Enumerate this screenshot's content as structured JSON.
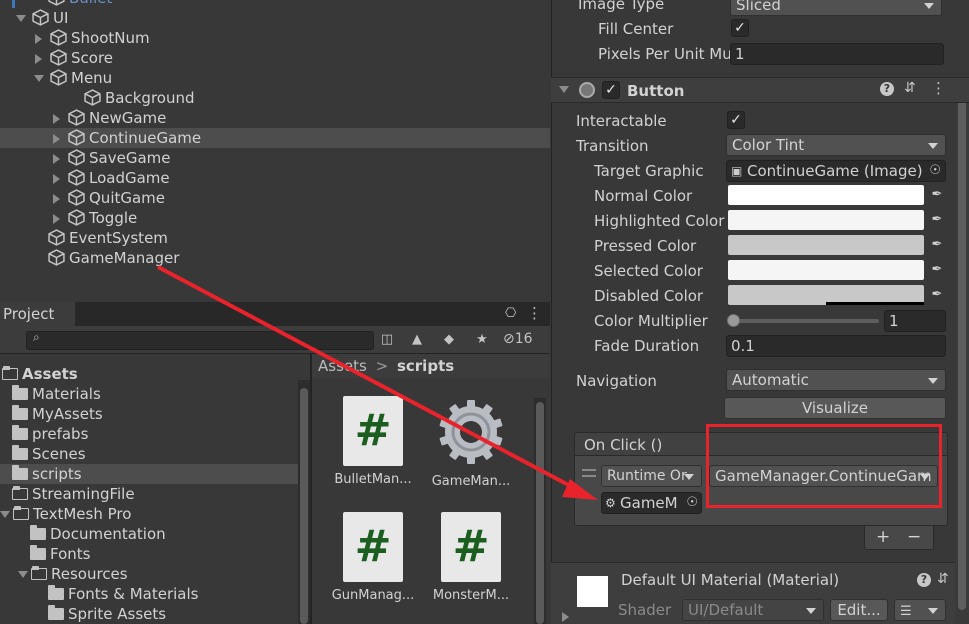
{
  "hierarchy": {
    "items": [
      {
        "label": "Bullet",
        "indent": 48,
        "tri": "none"
      },
      {
        "label": "UI",
        "indent": 32,
        "tri": "down"
      },
      {
        "label": "ShootNum",
        "indent": 50,
        "tri": "right"
      },
      {
        "label": "Score",
        "indent": 50,
        "tri": "right"
      },
      {
        "label": "Menu",
        "indent": 50,
        "tri": "down"
      },
      {
        "label": "Background",
        "indent": 84,
        "tri": "none"
      },
      {
        "label": "NewGame",
        "indent": 68,
        "tri": "right"
      },
      {
        "label": "ContinueGame",
        "indent": 68,
        "tri": "right"
      },
      {
        "label": "SaveGame",
        "indent": 68,
        "tri": "right"
      },
      {
        "label": "LoadGame",
        "indent": 68,
        "tri": "right"
      },
      {
        "label": "QuitGame",
        "indent": 68,
        "tri": "right"
      },
      {
        "label": "Toggle",
        "indent": 68,
        "tri": "right"
      },
      {
        "label": "EventSystem",
        "indent": 48,
        "tri": "none"
      },
      {
        "label": "GameManager",
        "indent": 48,
        "tri": "none"
      }
    ]
  },
  "project": {
    "tab_label": "Project",
    "search_icon": "search-icon",
    "hidden_count": "16",
    "folders": [
      {
        "label": "Assets",
        "indent": 2,
        "open": true,
        "bold": true
      },
      {
        "label": "Materials",
        "indent": 12,
        "open": false
      },
      {
        "label": "MyAssets",
        "indent": 12,
        "open": false
      },
      {
        "label": "prefabs",
        "indent": 12,
        "open": false
      },
      {
        "label": "Scenes",
        "indent": 12,
        "open": false
      },
      {
        "label": "scripts",
        "indent": 12,
        "open": false,
        "selected": true
      },
      {
        "label": "StreamingFile",
        "indent": 12,
        "open": true,
        "empty": true
      },
      {
        "label": "TextMesh Pro",
        "indent": 12,
        "open": true,
        "tri": true
      },
      {
        "label": "Documentation",
        "indent": 30,
        "open": false
      },
      {
        "label": "Fonts",
        "indent": 30,
        "open": false
      },
      {
        "label": "Resources",
        "indent": 30,
        "open": true,
        "tri": true
      },
      {
        "label": "Fonts & Materials",
        "indent": 48,
        "open": false
      },
      {
        "label": "Sprite Assets",
        "indent": 48,
        "open": false
      }
    ],
    "breadcrumb": {
      "root": "Assets",
      "sep": ">",
      "current": "scripts"
    },
    "assets": [
      {
        "label": "BulletMan...",
        "type": "script"
      },
      {
        "label": "GameMan...",
        "type": "gear"
      },
      {
        "label": "GunManag...",
        "type": "script"
      },
      {
        "label": "MonsterM...",
        "type": "script"
      }
    ]
  },
  "inspector": {
    "top": {
      "image_type_label": "Image Type",
      "image_type_value": "Sliced",
      "fill_center_label": "Fill Center",
      "fill_center_check": "✓",
      "ppu_label": "Pixels Per Unit Mu",
      "ppu_value": "1"
    },
    "button_component": {
      "title": "Button",
      "enabled_check": "✓",
      "interactable_label": "Interactable",
      "interactable_check": "✓",
      "transition_label": "Transition",
      "transition_value": "Color Tint",
      "target_graphic_label": "Target Graphic",
      "target_graphic_value": "ContinueGame (Image)",
      "colors": [
        {
          "label": "Normal Color",
          "hex": "#ffffff"
        },
        {
          "label": "Highlighted Color",
          "hex": "#f5f5f5"
        },
        {
          "label": "Pressed Color",
          "hex": "#c8c8c8"
        },
        {
          "label": "Selected Color",
          "hex": "#f5f5f5"
        },
        {
          "label": "Disabled Color",
          "hex": "#c8c8c8"
        }
      ],
      "color_multiplier_label": "Color Multiplier",
      "color_multiplier_value": "1",
      "color_multiplier_fraction": 0.0,
      "fade_duration_label": "Fade Duration",
      "fade_duration_value": "0.1",
      "navigation_label": "Navigation",
      "navigation_value": "Automatic",
      "visualize_label": "Visualize",
      "onclick_label": "On Click ()",
      "runtime_value": "Runtime Or",
      "function_value": "GameManager.ContinueGam",
      "object_value": "GameM",
      "add_label": "+",
      "remove_label": "−"
    },
    "material": {
      "title": "Default UI Material (Material)",
      "shader_label": "Shader",
      "shader_value": "UI/Default",
      "edit_label": "Edit..."
    }
  },
  "annotation_color": "#e8232b"
}
